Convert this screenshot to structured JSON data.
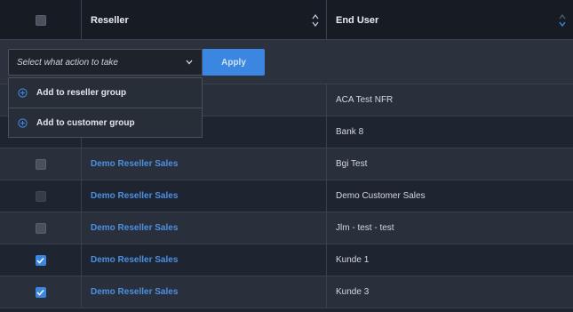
{
  "table": {
    "columns": [
      "Reseller",
      "End User"
    ],
    "rows": [
      {
        "reseller": "",
        "end_user": "ACA Test NFR",
        "checked": false
      },
      {
        "reseller": "",
        "end_user": "Bank 8",
        "checked": false
      },
      {
        "reseller": "Demo Reseller Sales",
        "end_user": "Bgi Test",
        "checked": false
      },
      {
        "reseller": "Demo Reseller Sales",
        "end_user": "Demo Customer Sales",
        "checked": false
      },
      {
        "reseller": "Demo Reseller Sales",
        "end_user": "Jlm - test - test",
        "checked": false
      },
      {
        "reseller": "Demo Reseller Sales",
        "end_user": "Kunde 1",
        "checked": true
      },
      {
        "reseller": "Demo Reseller Sales",
        "end_user": "Kunde 3",
        "checked": true
      }
    ]
  },
  "action_bar": {
    "select_placeholder": "Select what action to take",
    "apply_label": "Apply"
  },
  "dropdown": {
    "items": [
      "Add to reseller group",
      "Add to customer group"
    ]
  },
  "colors": {
    "accent": "#3b86e0",
    "link": "#4a90e2",
    "header_bg": "#171c24",
    "row_odd": "#1e2430",
    "row_even": "#2a303b"
  },
  "icons": [
    "chevron-down-icon",
    "sort-icon",
    "plus-circle-icon",
    "checkmark-icon"
  ]
}
